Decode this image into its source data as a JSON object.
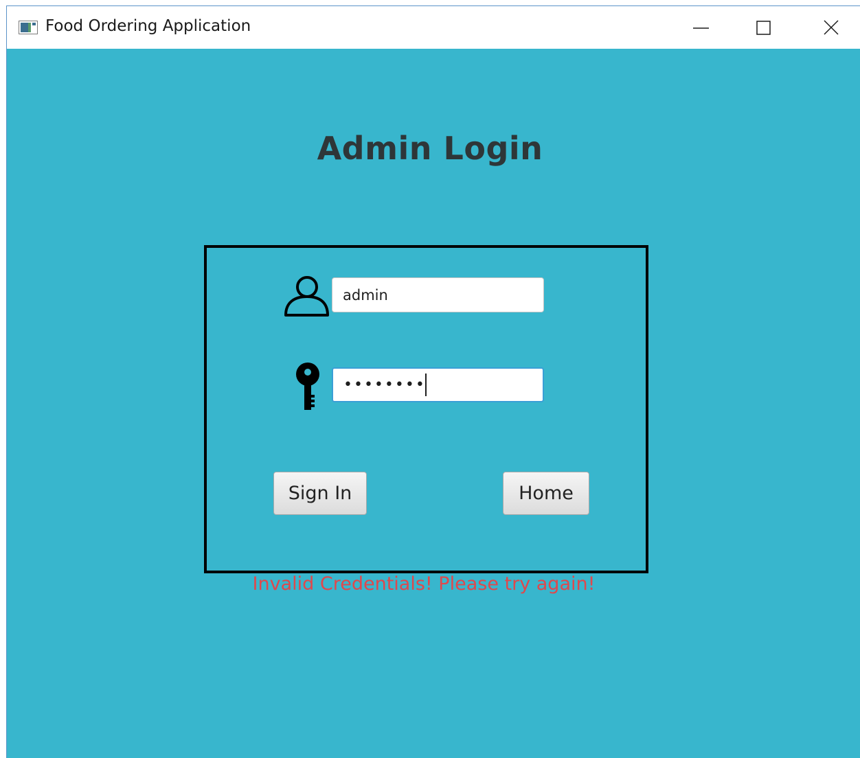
{
  "window": {
    "title": "Food Ordering Application",
    "controls": {
      "minimize_icon": "minimize-icon",
      "maximize_icon": "maximize-icon",
      "close_icon": "close-icon"
    }
  },
  "login": {
    "heading": "Admin Login",
    "username": {
      "icon": "user-icon",
      "value": "admin"
    },
    "password": {
      "icon": "key-icon",
      "value": "••••••••"
    },
    "sign_in_label": "Sign In",
    "home_label": "Home",
    "error_message": "Invalid Credentials! Please try again!"
  },
  "colors": {
    "background": "#38b6cd",
    "heading": "#2e3638",
    "error": "#e0484c",
    "focus_border": "#3a9fd6"
  }
}
